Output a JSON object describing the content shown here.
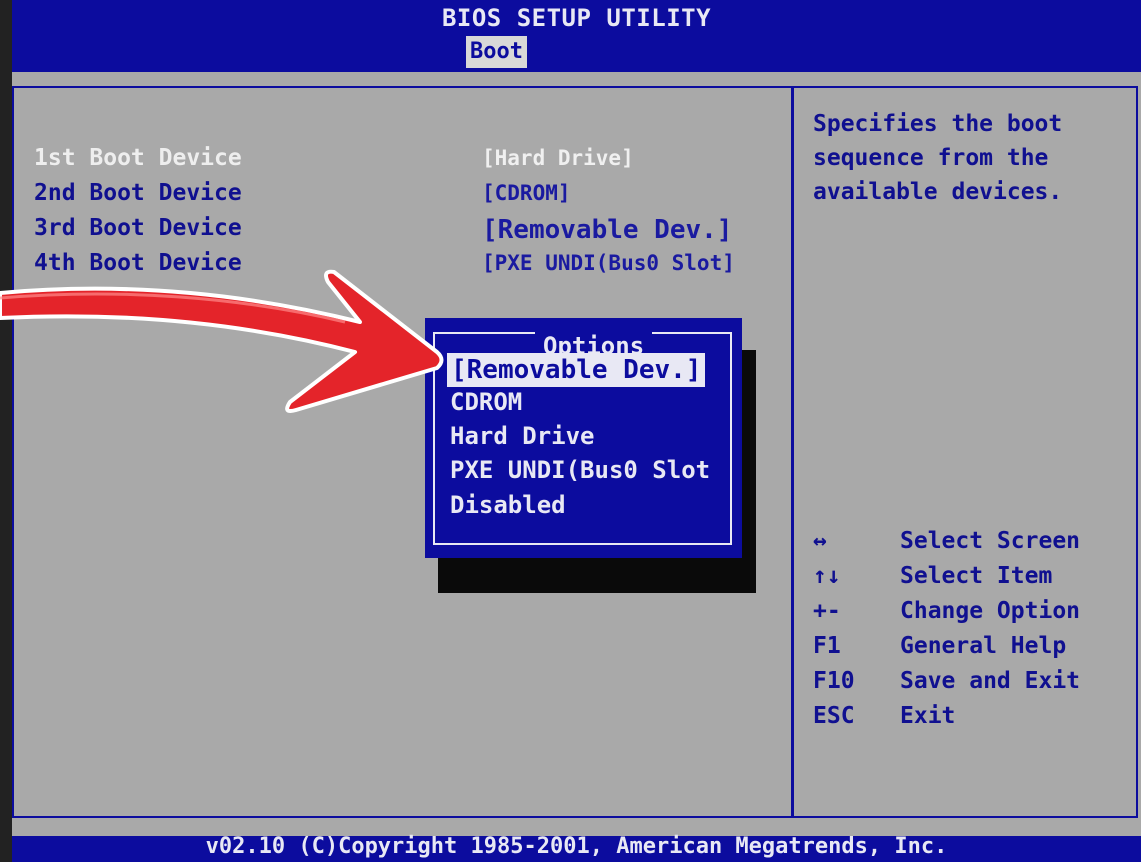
{
  "header": {
    "title": "BIOS SETUP UTILITY",
    "active_tab": "Boot"
  },
  "boot_devices": [
    {
      "label": "1st Boot Device",
      "value": "[Hard Drive]"
    },
    {
      "label": "2nd Boot Device",
      "value": "[CDROM]"
    },
    {
      "label": "3rd Boot Device",
      "value": "[Removable Dev.]"
    },
    {
      "label": "4th Boot Device",
      "value": "[PXE UNDI(Bus0 Slot]"
    }
  ],
  "help": {
    "lines": [
      "Specifies the boot",
      "sequence from the",
      "available devices."
    ]
  },
  "options_popup": {
    "title": "Options",
    "items": [
      "[Removable Dev.]",
      "CDROM",
      "Hard Drive",
      "PXE UNDI(Bus0 Slot",
      "Disabled"
    ]
  },
  "keys": [
    {
      "key": "↔",
      "desc": "Select Screen"
    },
    {
      "key": "↑↓",
      "desc": "Select Item"
    },
    {
      "key": "+-",
      "desc": "Change Option"
    },
    {
      "key": "F1",
      "desc": "General Help"
    },
    {
      "key": "F10",
      "desc": "Save and Exit"
    },
    {
      "key": "ESC",
      "desc": "Exit"
    }
  ],
  "footer": {
    "text": "v02.10 (C)Copyright 1985-2001, American Megatrends, Inc."
  },
  "colors": {
    "bios_blue": "#0c0c9e",
    "panel_gray": "#a9a9a9",
    "highlight": "#e8e8f4",
    "arrow_red": "#e4242a"
  },
  "annotation": {
    "icon": "red-arrow-icon"
  }
}
